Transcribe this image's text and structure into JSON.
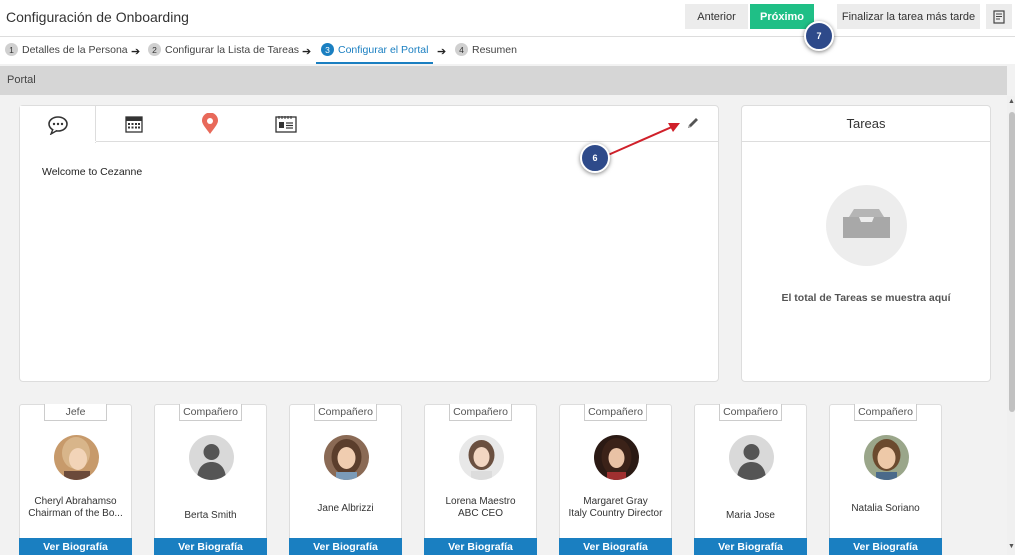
{
  "header": {
    "title": "Configuración de Onboarding",
    "prev_label": "Anterior",
    "next_label": "Próximo",
    "later_label": "Finalizar la tarea más tarde",
    "notes_icon": "document-icon"
  },
  "steps": [
    {
      "num": "1",
      "label": "Detalles de la Persona"
    },
    {
      "num": "2",
      "label": "Configurar la Lista de Tareas"
    },
    {
      "num": "3",
      "label": "Configurar el Portal"
    },
    {
      "num": "4",
      "label": "Resumen"
    }
  ],
  "section": {
    "title": "Portal"
  },
  "portal": {
    "tabs": [
      "chat-icon",
      "calendar-icon",
      "location-pin-icon",
      "contact-card-icon"
    ],
    "welcome_text": "Welcome to Cezanne"
  },
  "tasks": {
    "title": "Tareas",
    "empty_text": "El total de Tareas se muestra aquí"
  },
  "people": [
    {
      "role": "Jefe",
      "name": "Cheryl Abrahamso\nChairman of the Bo...",
      "bio": "Ver Biografía"
    },
    {
      "role": "Compañero",
      "name": "Berta Smith",
      "bio": "Ver Biografía"
    },
    {
      "role": "Compañero",
      "name": "Jane Albrizzi",
      "bio": "Ver Biografía"
    },
    {
      "role": "Compañero",
      "name": "Lorena Maestro\nABC CEO",
      "bio": "Ver Biografía"
    },
    {
      "role": "Compañero",
      "name": "Margaret Gray\nItaly Country Director",
      "bio": "Ver Biografía"
    },
    {
      "role": "Compañero",
      "name": "Maria Jose",
      "bio": "Ver Biografía"
    },
    {
      "role": "Compañero",
      "name": "Natalia Soriano",
      "bio": "Ver Biografía"
    }
  ],
  "markers": {
    "m6": "6",
    "m7": "7"
  },
  "colors": {
    "accent_blue": "#1a7fc1",
    "next_green": "#1fbf86",
    "marker": "#2e4a8a",
    "annotation_arrow": "#d0202a"
  }
}
